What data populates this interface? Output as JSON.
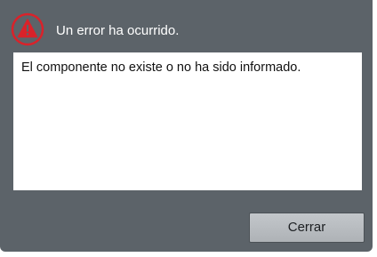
{
  "dialog": {
    "title": "Un error ha ocurrido.",
    "icon": "warning-triangle-icon",
    "message": "El componente no existe o no ha sido informado.",
    "close_label": "Cerrar"
  },
  "colors": {
    "background": "#5c6369",
    "icon_red": "#d9222a",
    "message_background": "#ffffff",
    "button_background": "#b9bdc1"
  }
}
